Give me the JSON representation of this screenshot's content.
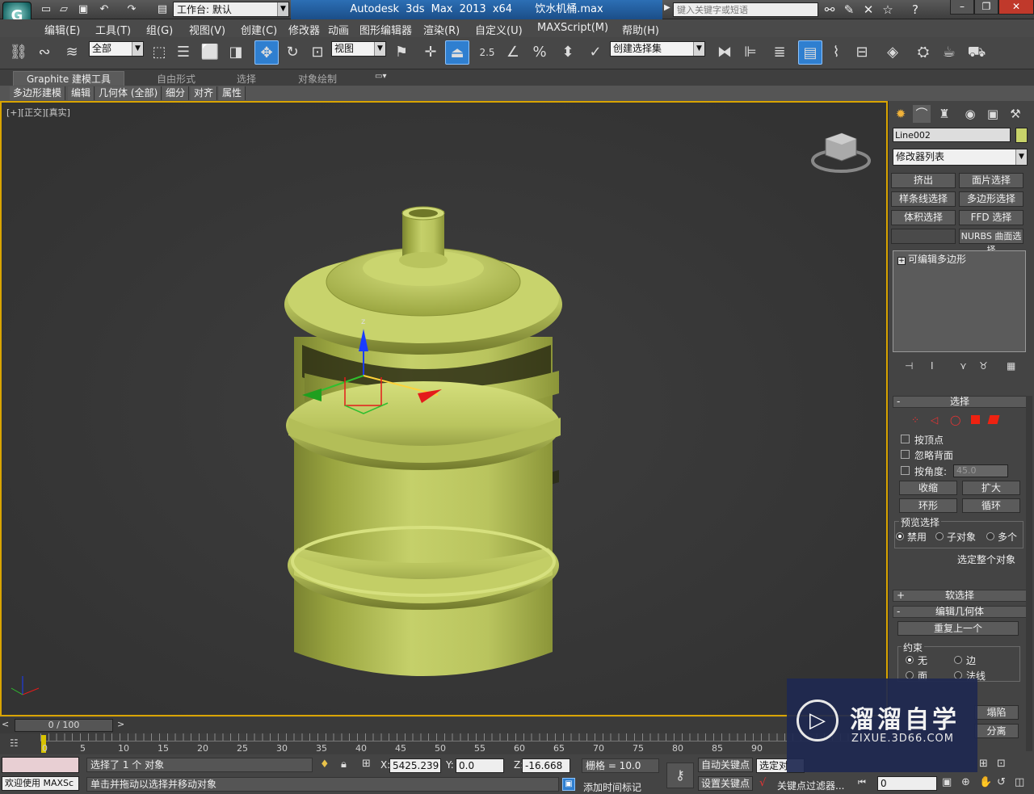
{
  "titlebar": {
    "workspace": "工作台: 默认",
    "app_title": "Autodesk 3ds Max  2013 x64",
    "file_name": "饮水机桶.max",
    "search_placeholder": "键入关键字或短语"
  },
  "menubar": [
    "编辑(E)",
    "工具(T)",
    "组(G)",
    "视图(V)",
    "创建(C)",
    "修改器",
    "动画",
    "图形编辑器",
    "渲染(R)",
    "自定义(U)",
    "MAXScript(M)",
    "帮助(H)"
  ],
  "toolbar": {
    "selection_filter": "全部",
    "reference_coord": "视图",
    "snap_angle": "2.5",
    "named_selection": "创建选择集"
  },
  "ribbon": {
    "tabs": [
      "Graphite 建模工具",
      "自由形式",
      "选择",
      "对象绘制"
    ],
    "subtabs": [
      "多边形建模",
      "编辑",
      "几何体 (全部)",
      "细分",
      "对齐",
      "属性"
    ]
  },
  "viewport": {
    "label": "[+][正交][真实]",
    "object_color": "#c8d36a",
    "gizmo": {
      "z_label": "z"
    }
  },
  "command_panel": {
    "object_name": "Line002",
    "object_color": "#c8d36a",
    "modifier_list": "修改器列表",
    "modifier_buttons": [
      "挤出",
      "面片选择",
      "样条线选择",
      "多边形选择",
      "体积选择",
      "FFD 选择",
      "",
      "NURBS 曲面选择"
    ],
    "stack_item": "可编辑多边形",
    "selection_rollout": {
      "title": "选择",
      "by_vertex": "按顶点",
      "ignore_backfacing": "忽略背面",
      "by_angle": "按角度:",
      "angle_value": "45.0",
      "shrink": "收缩",
      "grow": "扩大",
      "ring": "环形",
      "loop": "循环",
      "preview_title": "预览选择",
      "preview_options": [
        "禁用",
        "子对象",
        "多个"
      ],
      "select_whole": "选定整个对象"
    },
    "soft_selection": "软选择",
    "edit_geometry": {
      "title": "编辑几何体",
      "repeat_last": "重复上一个",
      "constraints_title": "约束",
      "constraints": [
        "无",
        "边",
        "面",
        "法线"
      ],
      "collapse": "塌陷",
      "detach": "分离"
    }
  },
  "timeline": {
    "frame_display": "0 / 100",
    "ticks": [
      "0",
      "5",
      "10",
      "15",
      "20",
      "25",
      "30",
      "35",
      "40",
      "45",
      "50",
      "55",
      "60",
      "65",
      "70",
      "75",
      "80",
      "85",
      "90"
    ]
  },
  "status": {
    "selected": "选择了 1 个 对象",
    "prompt": "单击并拖动以选择并移动对象",
    "welcome": "欢迎使用 MAXSc",
    "x_label": "X:",
    "x": "5425.239",
    "y_label": "Y:",
    "y": "0.0",
    "z_label": "Z:",
    "z": "-16.668",
    "grid": "栅格 = 10.0",
    "auto_key": "自动关键点",
    "set_key": "设置关键点",
    "selected_dropdown": "选定对",
    "key_filters": "关键点过滤器...",
    "add_time_tag": "添加时间标记",
    "frame": "0"
  },
  "watermark": {
    "brand": "溜溜自学",
    "url": "ZIXUE.3D66.COM"
  }
}
